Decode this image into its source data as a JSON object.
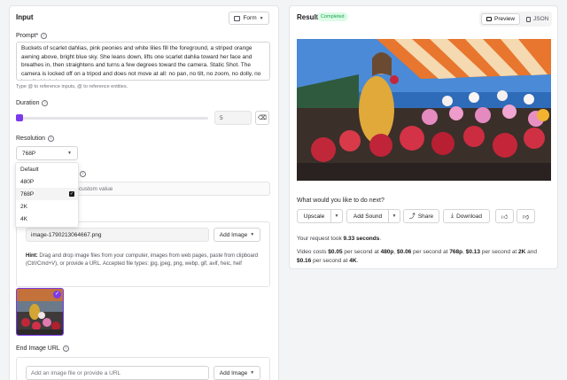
{
  "left": {
    "title": "Input",
    "form_label": "Form",
    "prompt_label": "Prompt*",
    "prompt_text": "Buckets of scarlet dahlias, pink peonies and white lilies fill the foreground, a striped orange awning above, bright blue sky. She leans down, lifts one scarlet dahlia toward her face and breathes in, then straightens and turns a few degrees toward the camera. Static Shot. The camera is locked off on a tripod and does not move at all: no pan, no tilt, no zoom, no dolly, no handheld shake.",
    "prompt_hint": "Type  @  to reference inputs,  @  to reference entities.",
    "duration_label": "Duration",
    "duration_value": "5",
    "duration_fraction": 0.0,
    "resolution_label": "Resolution",
    "resolution_value": "768P",
    "resolution_options": [
      "Default",
      "480P",
      "768P",
      "2K",
      "4K"
    ],
    "resolution_selected": "768P",
    "custom_placeholder": "custom value",
    "image_filename": "image-1790213064667.png",
    "add_image_label": "Add Image",
    "hint_label": "Hint:",
    "hint_text": "Drag and drop image files from your computer, images from web pages, paste from clipboard (Ctrl/Cmd+V), or provide a URL. Accepted file types: jpg, jpeg, png, webp, gif, avif, heic, heif",
    "end_image_label": "End Image URL",
    "end_image_placeholder": "Add an image file or provide a URL",
    "add_image_label_2": "Add Image"
  },
  "right": {
    "title": "Result",
    "status": "Completed",
    "preview_label": "Preview",
    "json_label": "JSON",
    "next_question": "What would you like to do next?",
    "actions": [
      "Upscale",
      "Add Sound",
      "Share",
      "Download"
    ],
    "request_prefix": "Your request took ",
    "request_time": "9.33 seconds",
    "request_suffix": ".",
    "cost_parts": [
      "Video costs ",
      "$0.05",
      " per second at ",
      "480p",
      ", ",
      "$0.06",
      " per second at ",
      "768p",
      ", ",
      "$0.13",
      " per second at ",
      "2K",
      " and ",
      "$0.16",
      " per second at ",
      "4K",
      "."
    ]
  },
  "colors": {
    "accent": "#7c3aed",
    "status_bg": "#dcfce7",
    "status_fg": "#16a34a"
  }
}
